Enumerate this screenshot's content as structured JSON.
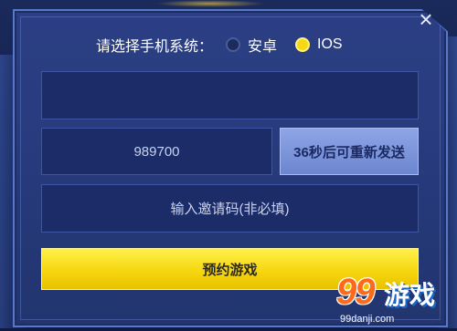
{
  "dialog": {
    "close_icon": "×",
    "os_select": {
      "label": "请选择手机系统：",
      "options": [
        {
          "label": "安卓",
          "selected": false
        },
        {
          "label": "IOS",
          "selected": true
        }
      ]
    },
    "phone_field": {
      "value": ""
    },
    "code_field": {
      "value": "989700"
    },
    "resend_button": {
      "label": "36秒后可重新发送"
    },
    "invite_field": {
      "placeholder": "输入邀请码(非必填)"
    },
    "reserve_button": {
      "label": "预约游戏"
    }
  },
  "watermark": {
    "logo": "99",
    "text": "游戏",
    "url": "99danji.com"
  },
  "colors": {
    "accent_yellow": "#f6d60e",
    "panel_blue": "#263a7c",
    "field_blue": "#1c2c68",
    "resend_blue": "#7c95db"
  }
}
